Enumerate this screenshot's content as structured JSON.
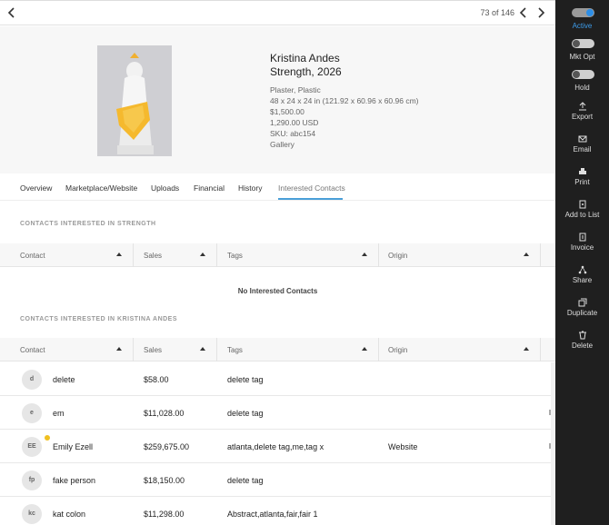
{
  "topbar": {
    "pager": "73 of 146"
  },
  "artwork": {
    "artist": "Kristina Andes",
    "title": "Strength, 2026",
    "medium": "Plaster, Plastic",
    "dimensions": "48 x 24 x 24 in (121.92 x 60.96 x 60.96 cm)",
    "price": "$1,500.00",
    "price2": "1,290.00 USD",
    "sku": "SKU: abc154",
    "location": "Gallery"
  },
  "tabs": [
    {
      "label": "Overview"
    },
    {
      "label": "Marketplace/Website"
    },
    {
      "label": "Uploads"
    },
    {
      "label": "Financial"
    },
    {
      "label": "History"
    },
    {
      "label": "Interested Contacts"
    }
  ],
  "section1": {
    "title": "CONTACTS INTERESTED IN STRENGTH",
    "empty": "No Interested Contacts"
  },
  "section2": {
    "title": "CONTACTS INTERESTED IN KRISTINA ANDES"
  },
  "columns": [
    "Contact",
    "Sales",
    "Tags",
    "Origin"
  ],
  "rows": [
    {
      "initials": "d",
      "name": "delete",
      "sales": "$58.00",
      "tags": "delete tag",
      "origin": ""
    },
    {
      "initials": "e",
      "name": "em",
      "sales": "$11,028.00",
      "tags": "delete tag",
      "origin": ""
    },
    {
      "initials": "EE",
      "name": "Emily Ezell",
      "sales": "$259,675.00",
      "tags": "atlanta,delete tag,me,tag x",
      "origin": "Website"
    },
    {
      "initials": "fp",
      "name": "fake person",
      "sales": "$18,150.00",
      "tags": "delete tag",
      "origin": ""
    },
    {
      "initials": "kc",
      "name": "kat colon",
      "sales": "$11,298.00",
      "tags": "Abstract,atlanta,fair,fair 1",
      "origin": ""
    }
  ],
  "sidebar": {
    "active": "Active",
    "mkt_opt": "Mkt Opt",
    "hold": "Hold",
    "export": "Export",
    "email": "Email",
    "print": "Print",
    "add_to_list": "Add to List",
    "invoice": "Invoice",
    "share": "Share",
    "duplicate": "Duplicate",
    "delete": "Delete"
  },
  "colors": {
    "accent": "#2d8ee6",
    "tab_underline": "#4a9fd8",
    "sidebar_bg": "#1f1f1f",
    "status_dot": "#f0c020"
  }
}
